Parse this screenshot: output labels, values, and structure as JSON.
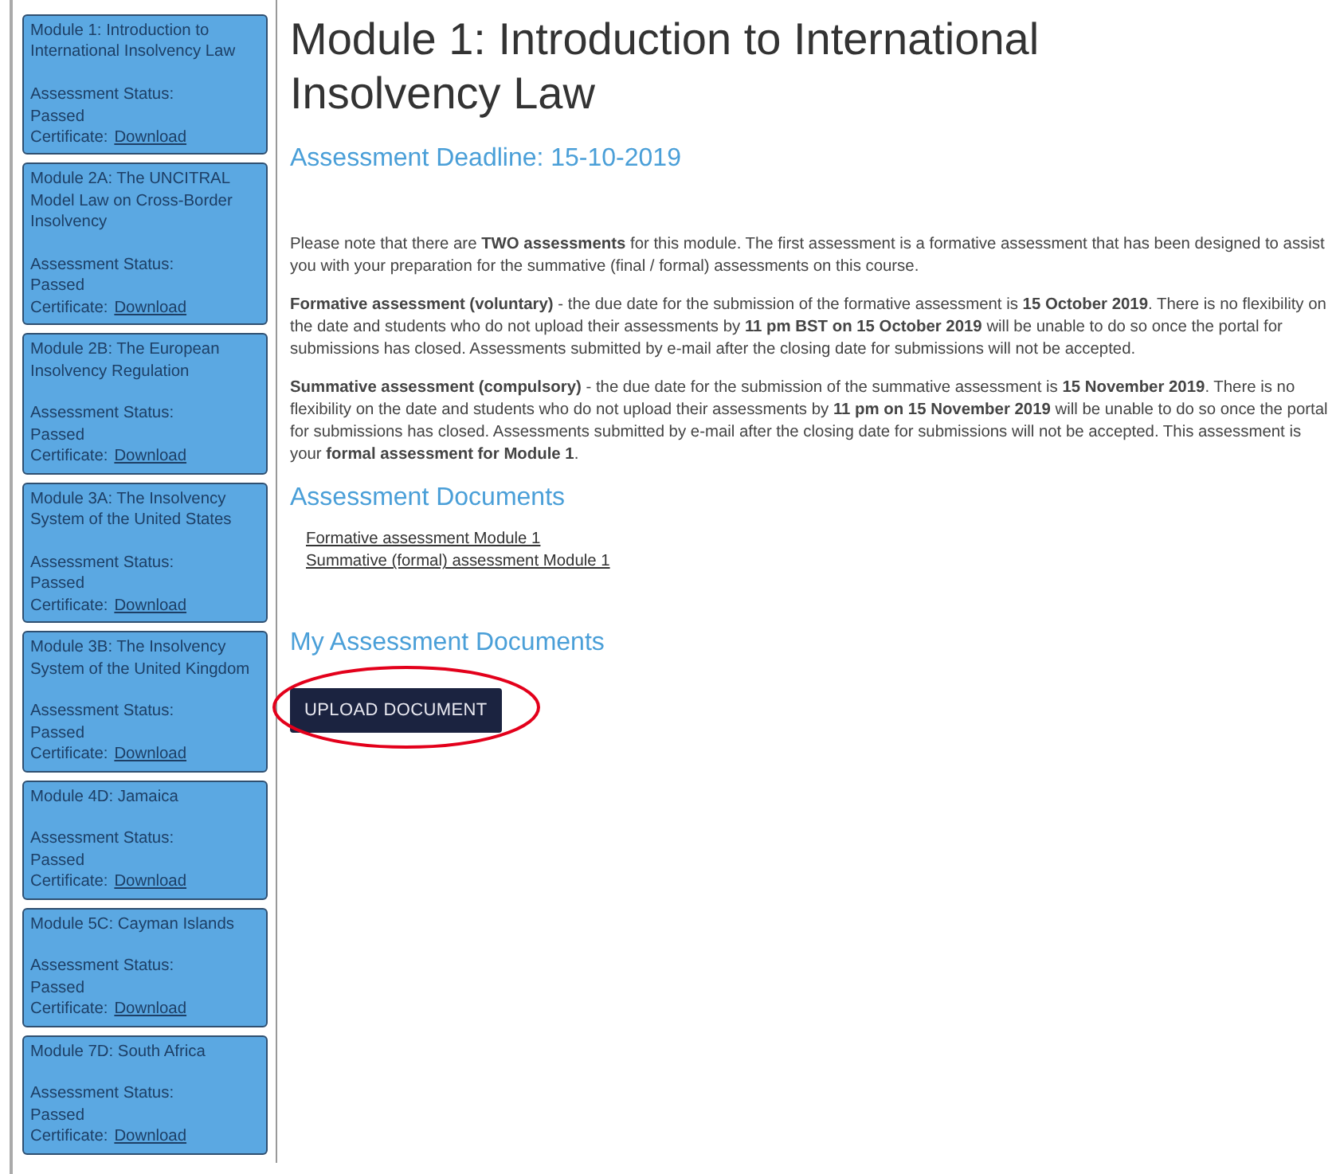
{
  "sidebar": {
    "modules": [
      {
        "title": "Module 1: Introduction to International Insolvency Law",
        "status_label": "Assessment Status:",
        "status": "Passed",
        "certificate_label": "Certificate:",
        "certificate_link": "Download"
      },
      {
        "title": "Module 2A: The UNCITRAL Model Law on Cross-Border Insolvency",
        "status_label": "Assessment Status:",
        "status": "Passed",
        "certificate_label": "Certificate:",
        "certificate_link": "Download"
      },
      {
        "title": "Module 2B: The European Insolvency Regulation",
        "status_label": "Assessment Status:",
        "status": "Passed",
        "certificate_label": "Certificate:",
        "certificate_link": "Download"
      },
      {
        "title": "Module 3A: The Insolvency System of the United States",
        "status_label": "Assessment Status:",
        "status": "Passed",
        "certificate_label": "Certificate:",
        "certificate_link": "Download"
      },
      {
        "title": "Module 3B: The Insolvency System of the United Kingdom",
        "status_label": "Assessment Status:",
        "status": "Passed",
        "certificate_label": "Certificate:",
        "certificate_link": "Download"
      },
      {
        "title": "Module 4D: Jamaica",
        "status_label": "Assessment Status:",
        "status": "Passed",
        "certificate_label": "Certificate:",
        "certificate_link": "Download"
      },
      {
        "title": "Module 5C: Cayman Islands",
        "status_label": "Assessment Status:",
        "status": "Passed",
        "certificate_label": "Certificate:",
        "certificate_link": "Download"
      },
      {
        "title": "Module 7D: South Africa",
        "status_label": "Assessment Status:",
        "status": "Passed",
        "certificate_label": "Certificate:",
        "certificate_link": "Download"
      }
    ]
  },
  "main": {
    "title": "Module 1: Introduction to International Insolvency Law",
    "deadline": "Assessment Deadline: 15-10-2019",
    "paragraphs": [
      "Please note that there are **TWO assessments** for this module. The first assessment is a formative assessment that has been designed to assist you with your preparation for the summative (final / formal) assessments on this course.",
      "**Formative assessment (voluntary)** - the due date for the submission of the formative assessment is **15 October 2019**. There is no flexibility on the date and students who do not upload their assessments by **11 pm BST on 15 October 2019** will be unable to do so once the portal for submissions has closed. Assessments submitted by e-mail after the closing date for submissions will not be accepted.",
      "**Summative assessment (compulsory)** - the due date for the submission of the summative assessment is **15 November 2019**. There is no flexibility on the date and students who do not upload their assessments by **11 pm on 15 November 2019** will be unable to do so once the portal for submissions has closed. Assessments submitted by e-mail after the closing date for submissions will not be accepted. This assessment is your **formal assessment for Module 1**."
    ],
    "documents_heading": "Assessment Documents",
    "documents": [
      "Formative assessment Module 1",
      "Summative (formal) assessment Module 1"
    ],
    "my_documents_heading": "My Assessment Documents",
    "upload_button": "UPLOAD DOCUMENT",
    "annotations": [
      {
        "kind": "ellipse",
        "color": "#e3001b"
      }
    ]
  }
}
